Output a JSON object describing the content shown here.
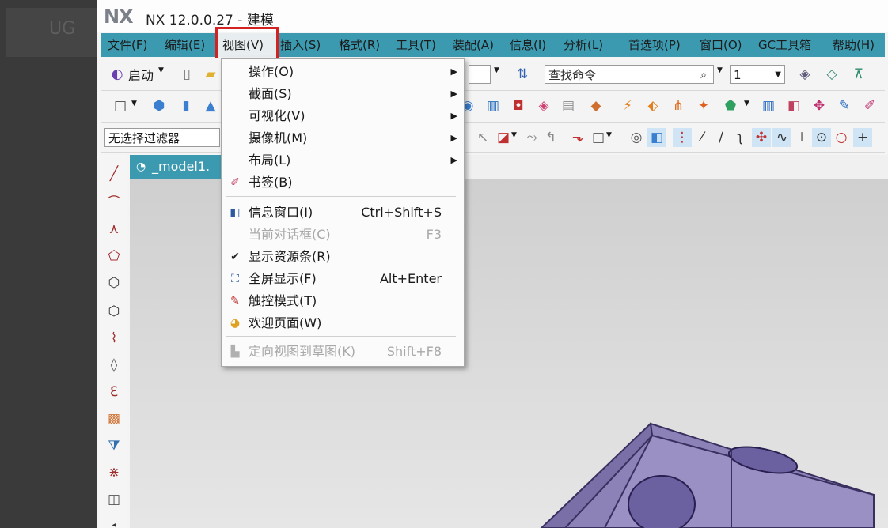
{
  "backdrop": {
    "text": "UG"
  },
  "title": {
    "logo": "NX",
    "text": "NX 12.0.0.27 - 建模"
  },
  "menubar": {
    "items": [
      "文件(F)",
      "编辑(E)",
      "视图(V)",
      "插入(S)",
      "格式(R)",
      "工具(T)",
      "装配(A)",
      "信息(I)",
      "分析(L)",
      "首选项(P)",
      "窗口(O)",
      "GC工具箱",
      "帮助(H)"
    ]
  },
  "toolbar1": {
    "start_label": "启动",
    "search_placeholder": "查找命令",
    "count_value": "1"
  },
  "toolbar3": {
    "filter_value": "无选择过滤器"
  },
  "graphics": {
    "tab_label": "_model1."
  },
  "view_menu": {
    "items": [
      {
        "label": "操作(O)",
        "shortcut": "",
        "submenu": true,
        "disabled": false,
        "icon": ""
      },
      {
        "label": "截面(S)",
        "shortcut": "",
        "submenu": true,
        "disabled": false,
        "icon": ""
      },
      {
        "label": "可视化(V)",
        "shortcut": "",
        "submenu": true,
        "disabled": false,
        "icon": ""
      },
      {
        "label": "摄像机(M)",
        "shortcut": "",
        "submenu": true,
        "disabled": false,
        "icon": ""
      },
      {
        "label": "布局(L)",
        "shortcut": "",
        "submenu": true,
        "disabled": false,
        "icon": ""
      },
      {
        "label": "书签(B)",
        "shortcut": "",
        "submenu": false,
        "disabled": false,
        "icon": "bookmark-icon"
      },
      {
        "label": "信息窗口(I)",
        "shortcut": "Ctrl+Shift+S",
        "submenu": false,
        "disabled": false,
        "icon": "info-window-icon"
      },
      {
        "label": "当前对话框(C)",
        "shortcut": "F3",
        "submenu": false,
        "disabled": true,
        "icon": ""
      },
      {
        "label": "显示资源条(R)",
        "shortcut": "",
        "submenu": false,
        "disabled": false,
        "icon": "check-icon"
      },
      {
        "label": "全屏显示(F)",
        "shortcut": "Alt+Enter",
        "submenu": false,
        "disabled": false,
        "icon": "fullscreen-icon"
      },
      {
        "label": "触控模式(T)",
        "shortcut": "",
        "submenu": false,
        "disabled": false,
        "icon": "touch-mode-icon"
      },
      {
        "label": "欢迎页面(W)",
        "shortcut": "",
        "submenu": false,
        "disabled": false,
        "icon": "welcome-page-icon"
      },
      {
        "label": "定向视图到草图(K)",
        "shortcut": "Shift+F8",
        "submenu": false,
        "disabled": true,
        "icon": "orient-view-icon"
      }
    ]
  },
  "colors": {
    "menubar": "#3c9ab0",
    "highlight": "#d32222",
    "model": "#8a7fb5"
  }
}
